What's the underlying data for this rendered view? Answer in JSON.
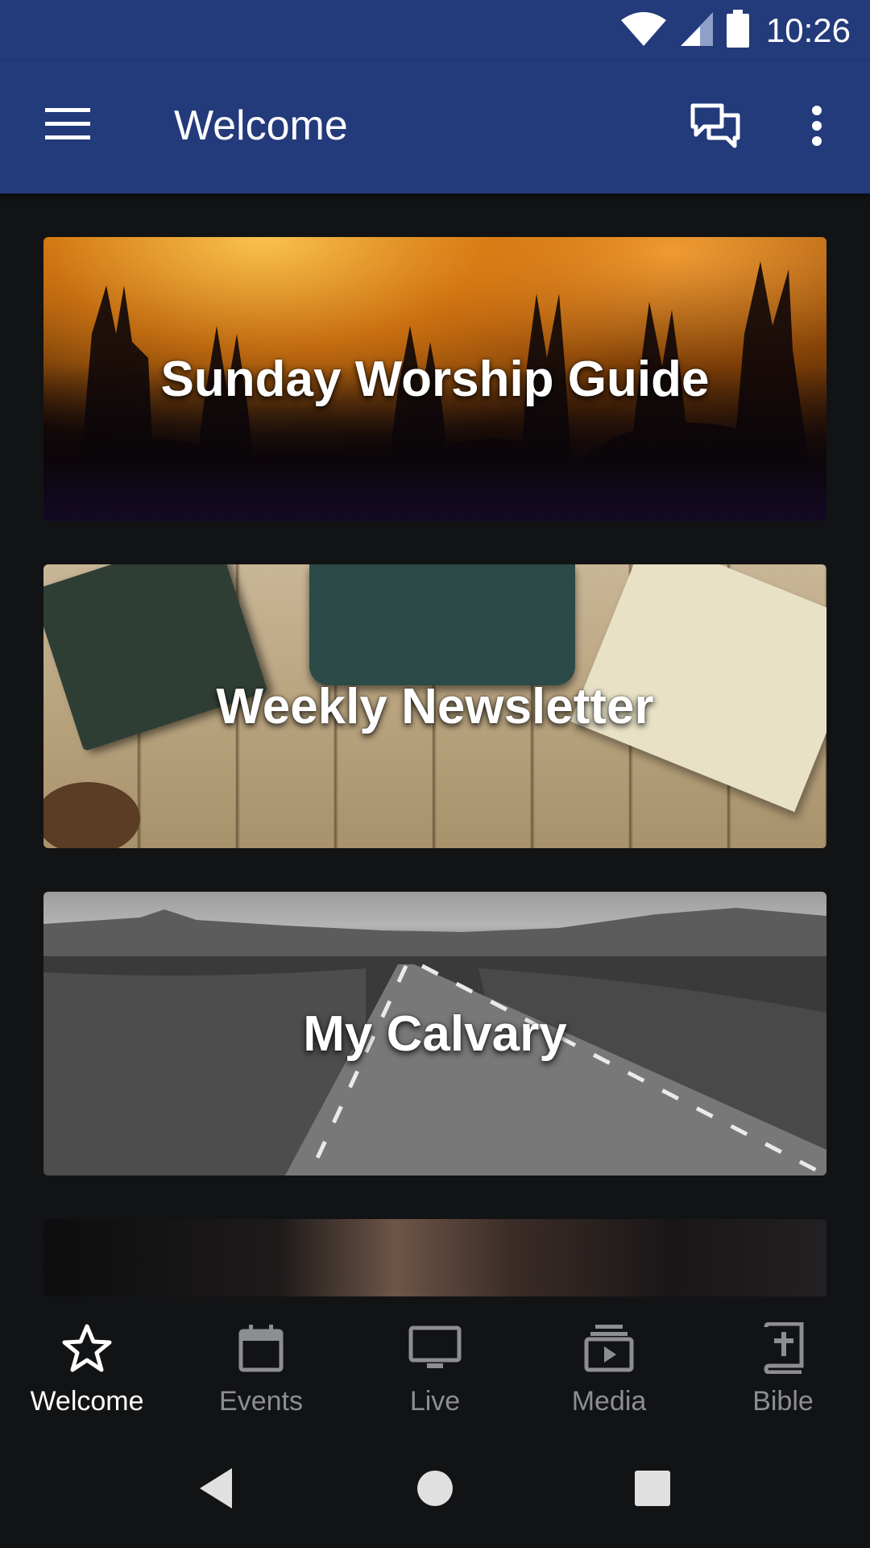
{
  "status_bar": {
    "time": "10:26",
    "icons": [
      "wifi-icon",
      "cell-signal-icon",
      "battery-icon"
    ]
  },
  "app_bar": {
    "title": "Welcome",
    "icons": [
      "menu-icon",
      "chat-icon",
      "more-vert-icon"
    ],
    "color": "#233a7b"
  },
  "cards": [
    {
      "title": "Sunday Worship Guide"
    },
    {
      "title": "Weekly Newsletter"
    },
    {
      "title": "My Calvary"
    },
    {
      "title": ""
    }
  ],
  "bottom_nav": {
    "items": [
      {
        "label": "Welcome",
        "icon": "star-icon",
        "active": true
      },
      {
        "label": "Events",
        "icon": "calendar-icon",
        "active": false
      },
      {
        "label": "Live",
        "icon": "tv-icon",
        "active": false
      },
      {
        "label": "Media",
        "icon": "media-icon",
        "active": false
      },
      {
        "label": "Bible",
        "icon": "bible-icon",
        "active": false
      }
    ],
    "active_color": "#ffffff",
    "inactive_color": "#8d8e91"
  },
  "system_nav": {
    "icons": [
      "back-icon",
      "home-icon",
      "recents-icon"
    ]
  }
}
